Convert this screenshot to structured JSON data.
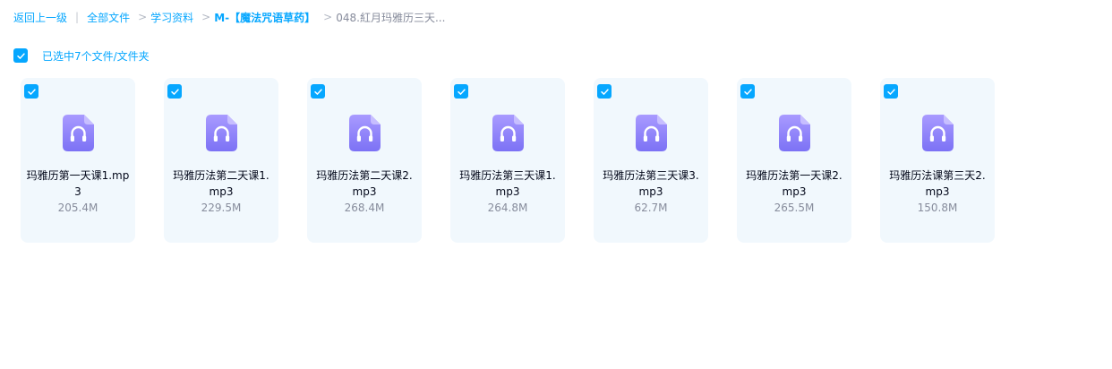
{
  "breadcrumb": {
    "back": "返回上一级",
    "separator_bar": "|",
    "separator_arrow": ">",
    "items": [
      "全部文件",
      "学习资料",
      "M-【魔法咒语草药】"
    ],
    "current": "048.紅月玛雅历三天..."
  },
  "selection": {
    "label": "已选中7个文件/文件夹"
  },
  "files": [
    {
      "name": "玛雅历第一天课1.mp3",
      "size": "205.4M"
    },
    {
      "name": "玛雅历法第二天课1.mp3",
      "size": "229.5M"
    },
    {
      "name": "玛雅历法第二天课2.mp3",
      "size": "268.4M"
    },
    {
      "name": "玛雅历法第三天课1.mp3",
      "size": "264.8M"
    },
    {
      "name": "玛雅历法第三天课3.mp3",
      "size": "62.7M"
    },
    {
      "name": "玛雅历法第一天课2.mp3",
      "size": "265.5M"
    },
    {
      "name": "玛雅历法课第三天2.mp3",
      "size": "150.8M"
    }
  ],
  "icons": {
    "checkbox": "check-icon",
    "file": "audio-file-icon"
  },
  "colors": {
    "accent": "#06a7ff",
    "card_background": "#f1f8fd",
    "icon_gradient_top": "#a99bff",
    "icon_gradient_bottom": "#7c72f5",
    "muted_text": "#878c9c"
  }
}
